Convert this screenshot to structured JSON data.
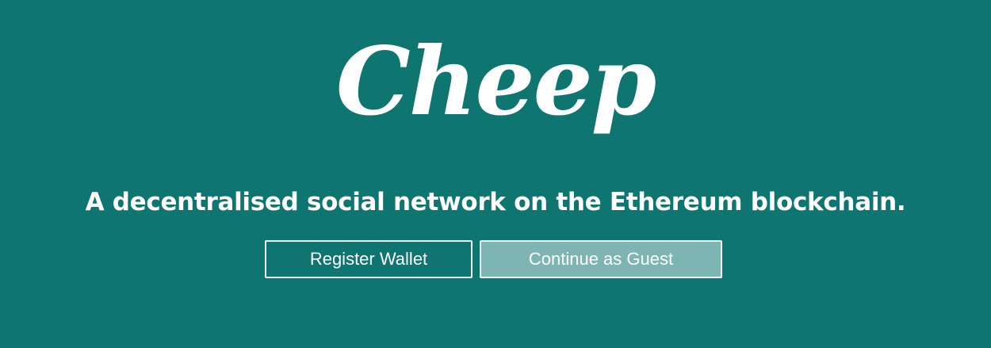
{
  "logo": {
    "text": "Cheep"
  },
  "tagline": "A decentralised social network on the Ethereum blockchain.",
  "buttons": {
    "register": "Register Wallet",
    "guest": "Continue as Guest"
  },
  "colors": {
    "background": "#0e7570",
    "guest_button": "#7cb5b2",
    "text": "#ffffff"
  }
}
